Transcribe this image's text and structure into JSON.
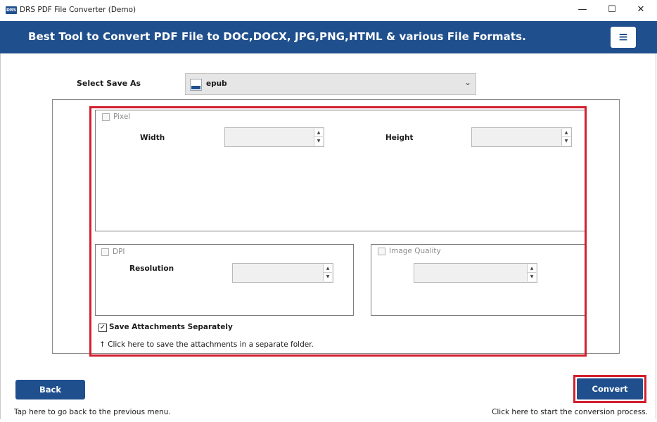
{
  "window": {
    "logo_text": "DRS",
    "title": "DRS PDF File Converter (Demo)",
    "minimize_glyph": "—",
    "maximize_glyph": "☐",
    "close_glyph": "✕"
  },
  "banner": {
    "title": "Best Tool to Convert PDF File to DOC,DOCX, JPG,PNG,HTML & various File Formats.",
    "menu_glyph": "≡"
  },
  "save_as": {
    "label": "Select Save As",
    "value": "epub",
    "arrow_glyph": "⌄"
  },
  "pixel": {
    "checkbox_label": "Pixel",
    "checked": false,
    "width_label": "Width",
    "width_value": "",
    "height_label": "Height",
    "height_value": ""
  },
  "dpi": {
    "checkbox_label": "DPI",
    "checked": false,
    "resolution_label": "Resolution",
    "resolution_value": ""
  },
  "image_quality": {
    "checkbox_label": "Image Quality",
    "checked": false,
    "value": ""
  },
  "attachments": {
    "label": "Save Attachments Separately",
    "checked": true,
    "check_glyph": "✓",
    "hint": "↑ Click here to save the attachments in a separate folder."
  },
  "spinner": {
    "up_glyph": "▲",
    "down_glyph": "▼"
  },
  "footer": {
    "back_label": "Back",
    "back_hint": "Tap here to go back to the previous menu.",
    "convert_label": "Convert",
    "convert_hint": "Click here to start the conversion process."
  },
  "colors": {
    "brand_blue": "#1f4f8d",
    "highlight_red": "#d2202e",
    "disabled_text": "#8c8c8c"
  }
}
